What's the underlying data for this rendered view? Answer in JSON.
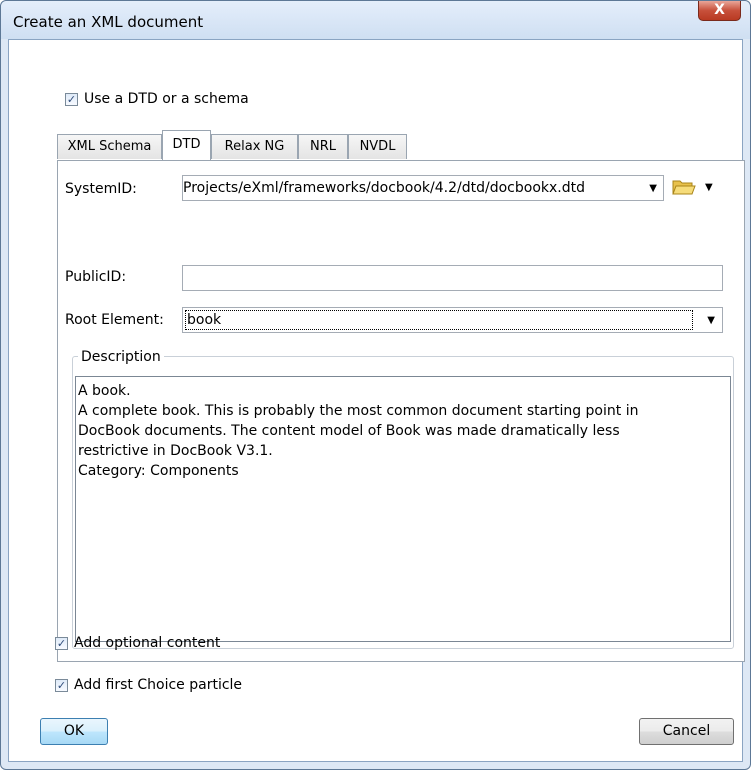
{
  "window": {
    "title": "Create an XML document",
    "close_label": "X"
  },
  "use_schema": {
    "label": "Use a DTD or a schema",
    "checked": true
  },
  "tabs": [
    {
      "label": "XML Schema",
      "active": false
    },
    {
      "label": "DTD",
      "active": true
    },
    {
      "label": "Relax NG",
      "active": false
    },
    {
      "label": "NRL",
      "active": false
    },
    {
      "label": "NVDL",
      "active": false
    }
  ],
  "form": {
    "system_id": {
      "label": "SystemID:",
      "value": "Projects/eXml/frameworks/docbook/4.2/dtd/docbookx.dtd"
    },
    "public_id": {
      "label": "PublicID:",
      "value": ""
    },
    "root_element": {
      "label": "Root Element:",
      "value": "book"
    }
  },
  "description": {
    "legend": "Description",
    "lines": [
      "A book.",
      "A complete book. This is probably the most common document starting point in",
      "DocBook documents. The content model of Book was made dramatically less",
      "restrictive in DocBook V3.1.",
      "Category: Components"
    ]
  },
  "options": {
    "optional_content": {
      "label": "Add optional content",
      "checked": true
    },
    "first_choice": {
      "label": "Add first Choice particle",
      "checked": true
    }
  },
  "buttons": {
    "ok": "OK",
    "cancel": "Cancel"
  }
}
